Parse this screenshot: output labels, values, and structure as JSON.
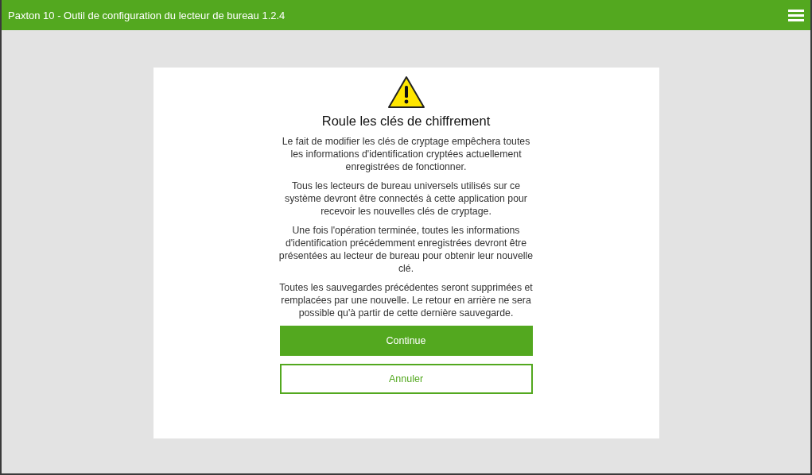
{
  "window": {
    "title": "Paxton 10 - Outil de configuration du lecteur de bureau 1.2.4"
  },
  "dialog": {
    "title": "Roule les clés de chiffrement",
    "paragraphs": [
      "Le fait de modifier les clés de cryptage empêchera toutes les informations d'identification cryptées actuellement enregistrées de fonctionner.",
      "Tous les lecteurs de bureau universels utilisés sur ce système devront être connectés à cette application pour recevoir les nouvelles clés de cryptage.",
      "Une fois l'opération terminée, toutes les informations d'identification précédemment enregistrées devront être présentées au lecteur de bureau pour obtenir leur nouvelle clé.",
      "Toutes les sauvegardes précédentes seront supprimées et remplacées par une nouvelle. Le retour en arrière ne sera possible qu'à partir de cette dernière sauvegarde."
    ],
    "buttons": [
      {
        "label": "Continue",
        "kind": "primary"
      },
      {
        "label": "Annuler",
        "kind": "secondary"
      }
    ]
  }
}
